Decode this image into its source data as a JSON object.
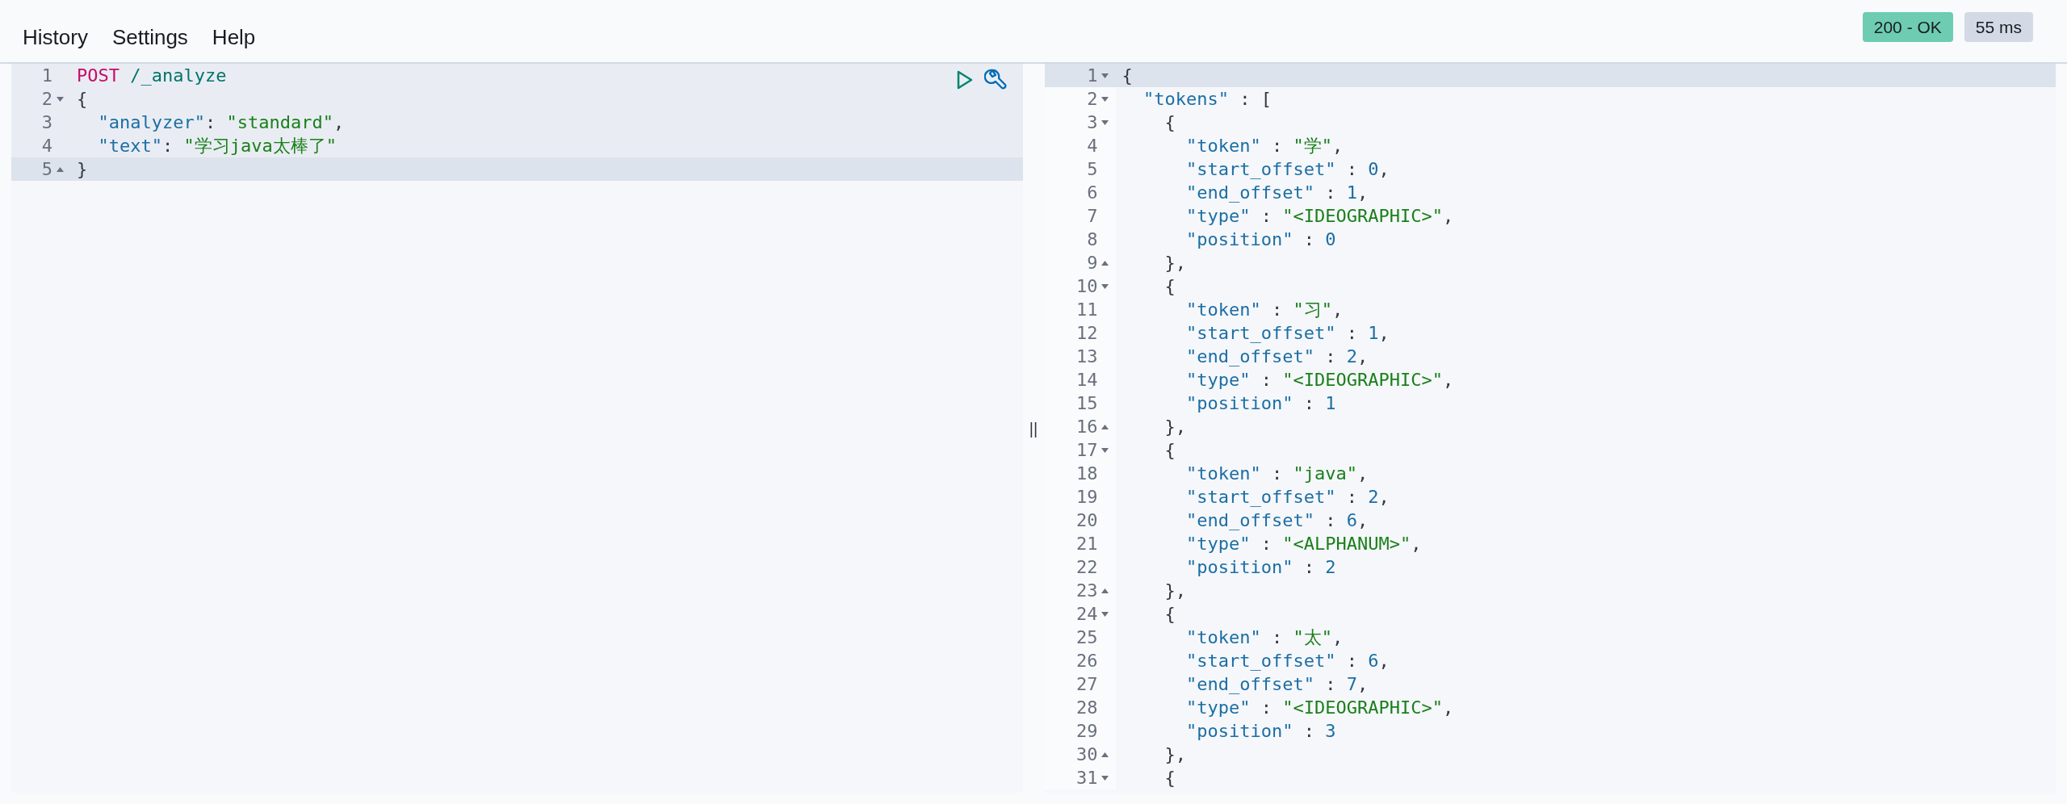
{
  "menu": [
    {
      "label": "History"
    },
    {
      "label": "Settings"
    },
    {
      "label": "Help"
    }
  ],
  "status": [
    {
      "label": "200 - OK",
      "color": "#6dccb1"
    },
    {
      "label": "55 ms",
      "color": "#d3dae6"
    }
  ],
  "request": {
    "lines": [
      {
        "number": "1",
        "fold_open": false,
        "fold_close": false,
        "in_request": true,
        "active": false,
        "segments": [
          {
            "text": "POST",
            "kind": "method"
          },
          {
            "text": " /_analyze",
            "kind": "url"
          }
        ]
      },
      {
        "number": "2",
        "fold_open": true,
        "fold_close": false,
        "in_request": true,
        "active": false,
        "segments": [
          {
            "text": "{",
            "kind": "punct"
          }
        ]
      },
      {
        "number": "3",
        "fold_open": false,
        "fold_close": false,
        "in_request": true,
        "active": false,
        "segments": [
          {
            "text": "  \"analyzer\"",
            "kind": "key"
          },
          {
            "text": ": ",
            "kind": "punct"
          },
          {
            "text": "\"standard\"",
            "kind": "string"
          },
          {
            "text": ",",
            "kind": "punct"
          }
        ]
      },
      {
        "number": "4",
        "fold_open": false,
        "fold_close": false,
        "in_request": true,
        "active": false,
        "segments": [
          {
            "text": "  \"text\"",
            "kind": "key"
          },
          {
            "text": ": ",
            "kind": "punct"
          },
          {
            "text": "\"学习java太棒了\"",
            "kind": "string"
          }
        ]
      },
      {
        "number": "5",
        "fold_open": false,
        "fold_close": true,
        "in_request": false,
        "active": true,
        "segments": [
          {
            "text": "}",
            "kind": "punct"
          }
        ]
      }
    ]
  },
  "splitter": "||",
  "response": {
    "lines": [
      {
        "number": "1",
        "fold_open": true,
        "fold_close": false,
        "active": true,
        "segments": [
          {
            "text": "{",
            "kind": "punct"
          }
        ]
      },
      {
        "number": "2",
        "fold_open": true,
        "fold_close": false,
        "active": false,
        "segments": [
          {
            "text": "  \"tokens\"",
            "kind": "key"
          },
          {
            "text": " : [",
            "kind": "punct"
          }
        ]
      },
      {
        "number": "3",
        "fold_open": true,
        "fold_close": false,
        "active": false,
        "segments": [
          {
            "text": "    {",
            "kind": "punct"
          }
        ]
      },
      {
        "number": "4",
        "fold_open": false,
        "fold_close": false,
        "active": false,
        "segments": [
          {
            "text": "      \"token\"",
            "kind": "key"
          },
          {
            "text": " : ",
            "kind": "punct"
          },
          {
            "text": "\"学\"",
            "kind": "string"
          },
          {
            "text": ",",
            "kind": "punct"
          }
        ]
      },
      {
        "number": "5",
        "fold_open": false,
        "fold_close": false,
        "active": false,
        "segments": [
          {
            "text": "      \"start_offset\"",
            "kind": "key"
          },
          {
            "text": " : ",
            "kind": "punct"
          },
          {
            "text": "0",
            "kind": "number"
          },
          {
            "text": ",",
            "kind": "punct"
          }
        ]
      },
      {
        "number": "6",
        "fold_open": false,
        "fold_close": false,
        "active": false,
        "segments": [
          {
            "text": "      \"end_offset\"",
            "kind": "key"
          },
          {
            "text": " : ",
            "kind": "punct"
          },
          {
            "text": "1",
            "kind": "number"
          },
          {
            "text": ",",
            "kind": "punct"
          }
        ]
      },
      {
        "number": "7",
        "fold_open": false,
        "fold_close": false,
        "active": false,
        "segments": [
          {
            "text": "      \"type\"",
            "kind": "key"
          },
          {
            "text": " : ",
            "kind": "punct"
          },
          {
            "text": "\"<IDEOGRAPHIC>\"",
            "kind": "string"
          },
          {
            "text": ",",
            "kind": "punct"
          }
        ]
      },
      {
        "number": "8",
        "fold_open": false,
        "fold_close": false,
        "active": false,
        "segments": [
          {
            "text": "      \"position\"",
            "kind": "key"
          },
          {
            "text": " : ",
            "kind": "punct"
          },
          {
            "text": "0",
            "kind": "number"
          }
        ]
      },
      {
        "number": "9",
        "fold_open": false,
        "fold_close": true,
        "active": false,
        "segments": [
          {
            "text": "    },",
            "kind": "punct"
          }
        ]
      },
      {
        "number": "10",
        "fold_open": true,
        "fold_close": false,
        "active": false,
        "segments": [
          {
            "text": "    {",
            "kind": "punct"
          }
        ]
      },
      {
        "number": "11",
        "fold_open": false,
        "fold_close": false,
        "active": false,
        "segments": [
          {
            "text": "      \"token\"",
            "kind": "key"
          },
          {
            "text": " : ",
            "kind": "punct"
          },
          {
            "text": "\"习\"",
            "kind": "string"
          },
          {
            "text": ",",
            "kind": "punct"
          }
        ]
      },
      {
        "number": "12",
        "fold_open": false,
        "fold_close": false,
        "active": false,
        "segments": [
          {
            "text": "      \"start_offset\"",
            "kind": "key"
          },
          {
            "text": " : ",
            "kind": "punct"
          },
          {
            "text": "1",
            "kind": "number"
          },
          {
            "text": ",",
            "kind": "punct"
          }
        ]
      },
      {
        "number": "13",
        "fold_open": false,
        "fold_close": false,
        "active": false,
        "segments": [
          {
            "text": "      \"end_offset\"",
            "kind": "key"
          },
          {
            "text": " : ",
            "kind": "punct"
          },
          {
            "text": "2",
            "kind": "number"
          },
          {
            "text": ",",
            "kind": "punct"
          }
        ]
      },
      {
        "number": "14",
        "fold_open": false,
        "fold_close": false,
        "active": false,
        "segments": [
          {
            "text": "      \"type\"",
            "kind": "key"
          },
          {
            "text": " : ",
            "kind": "punct"
          },
          {
            "text": "\"<IDEOGRAPHIC>\"",
            "kind": "string"
          },
          {
            "text": ",",
            "kind": "punct"
          }
        ]
      },
      {
        "number": "15",
        "fold_open": false,
        "fold_close": false,
        "active": false,
        "segments": [
          {
            "text": "      \"position\"",
            "kind": "key"
          },
          {
            "text": " : ",
            "kind": "punct"
          },
          {
            "text": "1",
            "kind": "number"
          }
        ]
      },
      {
        "number": "16",
        "fold_open": false,
        "fold_close": true,
        "active": false,
        "segments": [
          {
            "text": "    },",
            "kind": "punct"
          }
        ]
      },
      {
        "number": "17",
        "fold_open": true,
        "fold_close": false,
        "active": false,
        "segments": [
          {
            "text": "    {",
            "kind": "punct"
          }
        ]
      },
      {
        "number": "18",
        "fold_open": false,
        "fold_close": false,
        "active": false,
        "segments": [
          {
            "text": "      \"token\"",
            "kind": "key"
          },
          {
            "text": " : ",
            "kind": "punct"
          },
          {
            "text": "\"java\"",
            "kind": "string"
          },
          {
            "text": ",",
            "kind": "punct"
          }
        ]
      },
      {
        "number": "19",
        "fold_open": false,
        "fold_close": false,
        "active": false,
        "segments": [
          {
            "text": "      \"start_offset\"",
            "kind": "key"
          },
          {
            "text": " : ",
            "kind": "punct"
          },
          {
            "text": "2",
            "kind": "number"
          },
          {
            "text": ",",
            "kind": "punct"
          }
        ]
      },
      {
        "number": "20",
        "fold_open": false,
        "fold_close": false,
        "active": false,
        "segments": [
          {
            "text": "      \"end_offset\"",
            "kind": "key"
          },
          {
            "text": " : ",
            "kind": "punct"
          },
          {
            "text": "6",
            "kind": "number"
          },
          {
            "text": ",",
            "kind": "punct"
          }
        ]
      },
      {
        "number": "21",
        "fold_open": false,
        "fold_close": false,
        "active": false,
        "segments": [
          {
            "text": "      \"type\"",
            "kind": "key"
          },
          {
            "text": " : ",
            "kind": "punct"
          },
          {
            "text": "\"<ALPHANUM>\"",
            "kind": "string"
          },
          {
            "text": ",",
            "kind": "punct"
          }
        ]
      },
      {
        "number": "22",
        "fold_open": false,
        "fold_close": false,
        "active": false,
        "segments": [
          {
            "text": "      \"position\"",
            "kind": "key"
          },
          {
            "text": " : ",
            "kind": "punct"
          },
          {
            "text": "2",
            "kind": "number"
          }
        ]
      },
      {
        "number": "23",
        "fold_open": false,
        "fold_close": true,
        "active": false,
        "segments": [
          {
            "text": "    },",
            "kind": "punct"
          }
        ]
      },
      {
        "number": "24",
        "fold_open": true,
        "fold_close": false,
        "active": false,
        "segments": [
          {
            "text": "    {",
            "kind": "punct"
          }
        ]
      },
      {
        "number": "25",
        "fold_open": false,
        "fold_close": false,
        "active": false,
        "segments": [
          {
            "text": "      \"token\"",
            "kind": "key"
          },
          {
            "text": " : ",
            "kind": "punct"
          },
          {
            "text": "\"太\"",
            "kind": "string"
          },
          {
            "text": ",",
            "kind": "punct"
          }
        ]
      },
      {
        "number": "26",
        "fold_open": false,
        "fold_close": false,
        "active": false,
        "segments": [
          {
            "text": "      \"start_offset\"",
            "kind": "key"
          },
          {
            "text": " : ",
            "kind": "punct"
          },
          {
            "text": "6",
            "kind": "number"
          },
          {
            "text": ",",
            "kind": "punct"
          }
        ]
      },
      {
        "number": "27",
        "fold_open": false,
        "fold_close": false,
        "active": false,
        "segments": [
          {
            "text": "      \"end_offset\"",
            "kind": "key"
          },
          {
            "text": " : ",
            "kind": "punct"
          },
          {
            "text": "7",
            "kind": "number"
          },
          {
            "text": ",",
            "kind": "punct"
          }
        ]
      },
      {
        "number": "28",
        "fold_open": false,
        "fold_close": false,
        "active": false,
        "segments": [
          {
            "text": "      \"type\"",
            "kind": "key"
          },
          {
            "text": " : ",
            "kind": "punct"
          },
          {
            "text": "\"<IDEOGRAPHIC>\"",
            "kind": "string"
          },
          {
            "text": ",",
            "kind": "punct"
          }
        ]
      },
      {
        "number": "29",
        "fold_open": false,
        "fold_close": false,
        "active": false,
        "segments": [
          {
            "text": "      \"position\"",
            "kind": "key"
          },
          {
            "text": " : ",
            "kind": "punct"
          },
          {
            "text": "3",
            "kind": "number"
          }
        ]
      },
      {
        "number": "30",
        "fold_open": false,
        "fold_close": true,
        "active": false,
        "segments": [
          {
            "text": "    },",
            "kind": "punct"
          }
        ]
      },
      {
        "number": "31",
        "fold_open": true,
        "fold_close": false,
        "active": false,
        "segments": [
          {
            "text": "    {",
            "kind": "punct"
          }
        ]
      }
    ]
  }
}
